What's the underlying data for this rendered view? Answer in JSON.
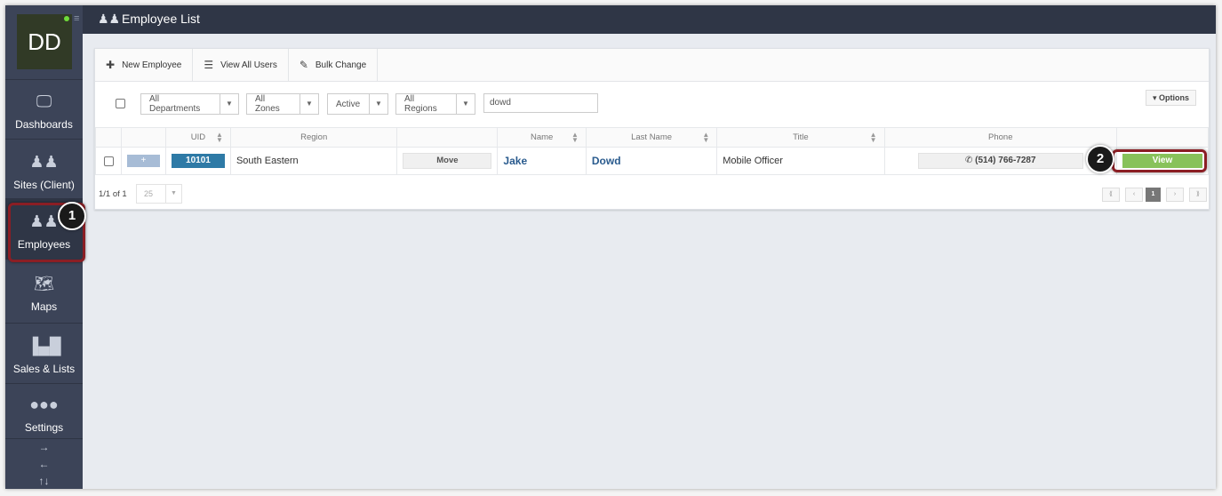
{
  "app": {
    "user_initials": "DD",
    "page_title": "Employee List"
  },
  "sidebar": {
    "items": [
      {
        "label": "Dashboards",
        "icon": "monitor-icon"
      },
      {
        "label": "Sites (Client)",
        "icon": "sites-icon"
      },
      {
        "label": "Employees",
        "icon": "employees-icon"
      },
      {
        "label": "Maps",
        "icon": "map-icon"
      },
      {
        "label": "Sales & Lists",
        "icon": "chart-icon"
      },
      {
        "label": "Settings",
        "icon": "ellipsis-icon"
      }
    ],
    "arrows": [
      "→",
      "←",
      "↑↓"
    ]
  },
  "toolbar": {
    "new_employee": "New Employee",
    "view_all_users": "View All Users",
    "bulk_change": "Bulk Change"
  },
  "filters": {
    "departments": "All Departments",
    "zones": "All Zones",
    "status": "Active",
    "regions": "All Regions",
    "search_value": "dowd",
    "options_label": "▾ Options"
  },
  "table": {
    "headers": {
      "uid": "UID",
      "region": "Region",
      "name": "Name",
      "last_name": "Last Name",
      "title": "Title",
      "phone": "Phone"
    },
    "row": {
      "plus": "+",
      "uid": "10101",
      "region": "South Eastern",
      "move": "Move",
      "name": "Jake",
      "last_name": "Dowd",
      "title": "Mobile Officer",
      "phone": "(514) 766-7287",
      "view": "View"
    }
  },
  "footer": {
    "count": "1/1 of 1",
    "per_page": "25",
    "pages": [
      "⟪",
      "‹",
      "1",
      "›",
      "⟫"
    ]
  },
  "annotations": {
    "step1": "1",
    "step2": "2"
  },
  "colors": {
    "sidebar_bg": "#3c4458",
    "header_bg": "#2f3646",
    "uid_blue": "#2e7aa6",
    "view_green": "#88c25a",
    "highlight": "#8b1e24"
  }
}
